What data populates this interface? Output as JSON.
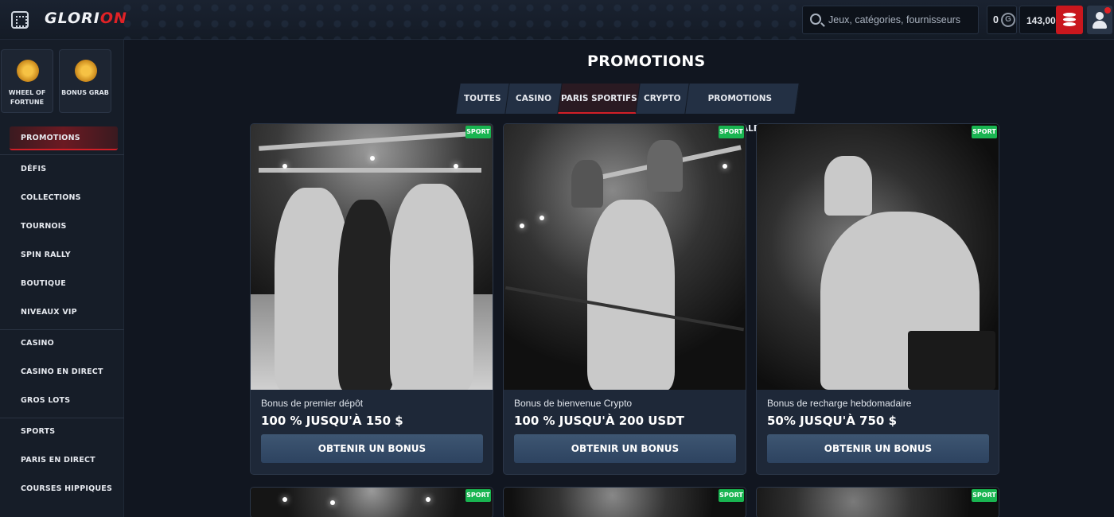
{
  "header": {
    "logo": {
      "part1": "GLORI",
      "part2": "ON"
    },
    "search_placeholder": "Jeux, catégories, fournisseurs",
    "coins": "0",
    "coin_symbol": "G",
    "balance": "143,00 $"
  },
  "sidebar": {
    "tiles": [
      {
        "label": "WHEEL OF FORTUNE",
        "icon": "wheel-icon"
      },
      {
        "label": "BONUS GRAB",
        "icon": "bonus-coin-icon"
      }
    ],
    "items": [
      "PROMOTIONS",
      "DÉFIS",
      "COLLECTIONS",
      "TOURNOIS",
      "SPIN RALLY",
      "BOUTIQUE",
      "NIVEAUX VIP",
      "CASINO",
      "CASINO EN DIRECT",
      "GROS LOTS",
      "SPORTS",
      "PARIS EN DIRECT",
      "COURSES HIPPIQUES"
    ]
  },
  "main": {
    "title": "PROMOTIONS",
    "tabs": [
      "TOUTES",
      "CASINO",
      "PARIS SPORTIFS",
      "CRYPTO",
      "PROMOTIONS SPÉCIALES"
    ],
    "active_tab": "PARIS SPORTIFS",
    "cards": [
      {
        "badge": "SPORT",
        "subtitle": "Bonus de premier dépôt",
        "headline": "100 % JUSQU'À 150 $",
        "cta": "OBTENIR UN BONUS"
      },
      {
        "badge": "SPORT",
        "subtitle": "Bonus de bienvenue Crypto",
        "headline": "100 % JUSQU'À 200 USDT",
        "cta": "OBTENIR UN BONUS"
      },
      {
        "badge": "SPORT",
        "subtitle": "Bonus de recharge hebdomadaire",
        "headline": "50% JUSQU'À 750 $",
        "cta": "OBTENIR UN BONUS"
      }
    ],
    "row2_badges": [
      "SPORT",
      "SPORT",
      "SPORT"
    ]
  },
  "colors": {
    "accent": "#d21f27",
    "badge": "#19b551",
    "bg": "#111620",
    "panel": "#1e2838"
  }
}
